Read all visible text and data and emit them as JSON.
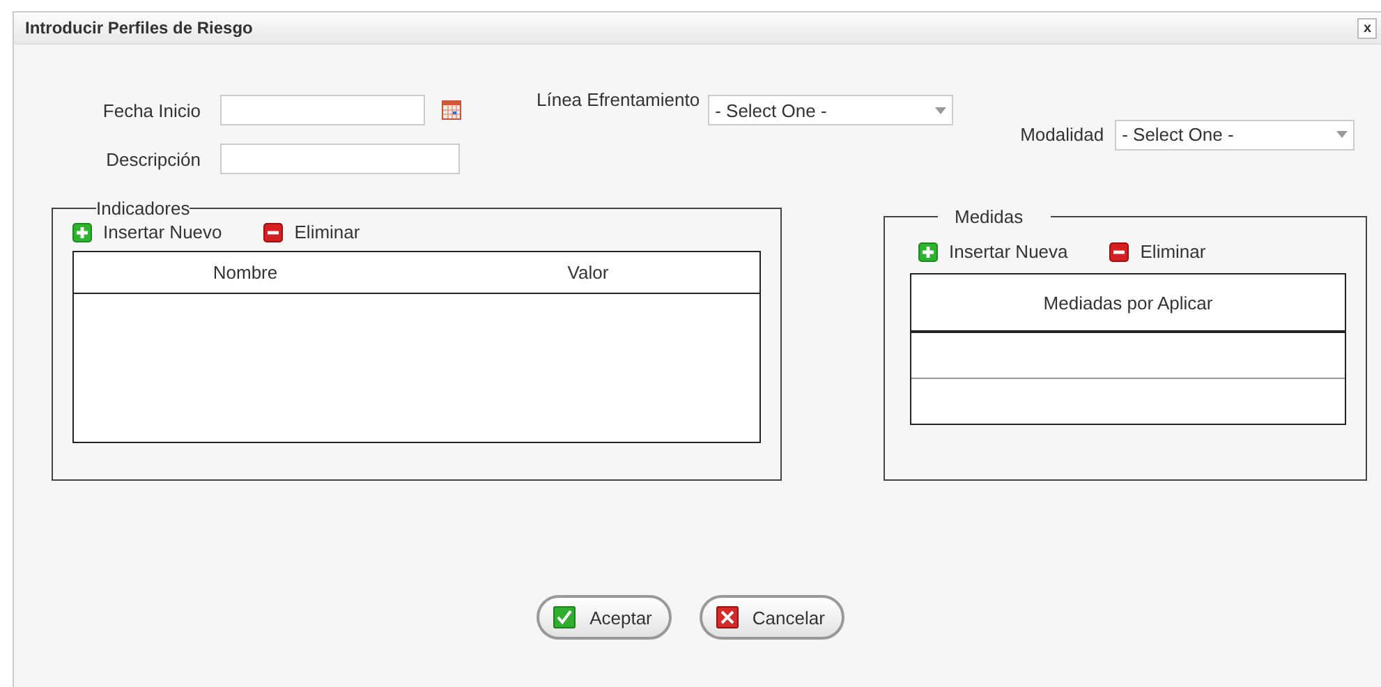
{
  "window": {
    "title": "Introducir Perfiles de Riesgo",
    "close": "x"
  },
  "form": {
    "date_field": {
      "label": "Fecha Inicio"
    },
    "text_field": {
      "label": "Descripción"
    },
    "selects": [
      {
        "label": "Línea Efrentamiento",
        "value": "- Select One -"
      },
      {
        "label": "Modalidad",
        "value": "- Select One -"
      }
    ]
  },
  "indicadores": {
    "legend": "Indicadores",
    "actions": [
      {
        "kind": "add",
        "label": "Insertar Nuevo"
      },
      {
        "kind": "remove",
        "label": "Eliminar"
      }
    ],
    "columns": [
      "Nombre",
      "Valor"
    ]
  },
  "medidas": {
    "legend": "Medidas",
    "actions": [
      {
        "kind": "add",
        "label": "Insertar Nueva"
      },
      {
        "kind": "remove",
        "label": "Eliminar"
      }
    ],
    "columns": [
      "Mediadas por Aplicar"
    ]
  },
  "buttons": [
    {
      "kind": "accept",
      "label": "Aceptar"
    },
    {
      "kind": "cancel",
      "label": "Cancelar"
    }
  ]
}
